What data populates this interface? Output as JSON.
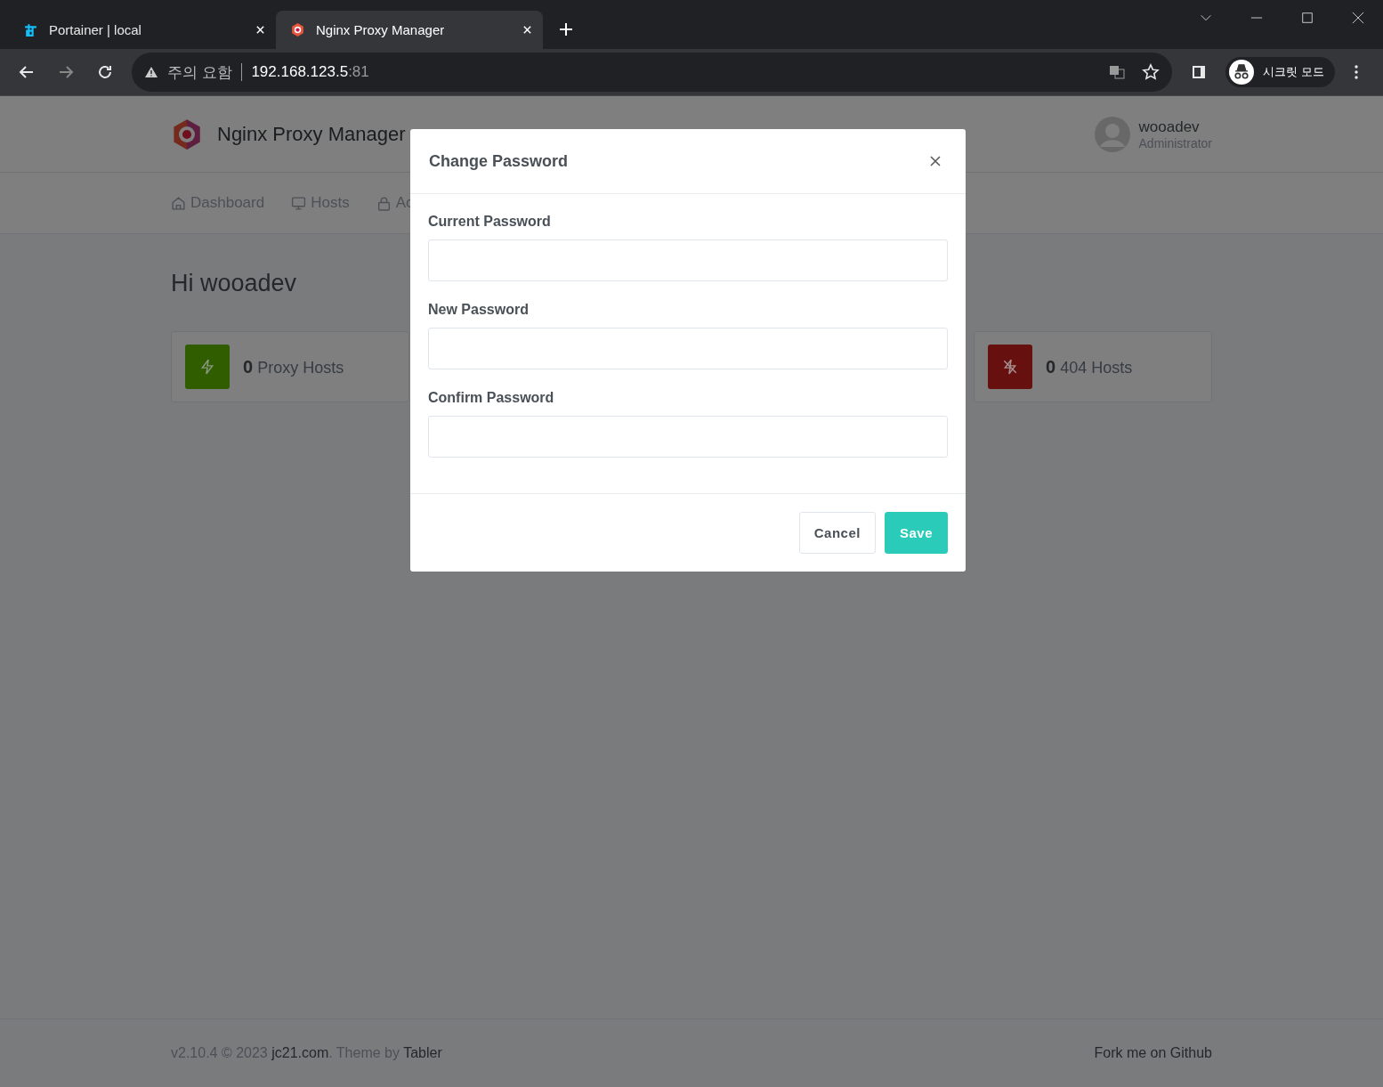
{
  "browser": {
    "tabs": [
      {
        "title": "Portainer | local",
        "selected": false,
        "kind": "crane"
      },
      {
        "title": "Nginx Proxy Manager",
        "selected": true,
        "kind": "hexagon"
      }
    ],
    "address": {
      "warning": "주의 요함",
      "host": "192.168.123.5",
      "port": ":81"
    },
    "profile": "시크릿 모드"
  },
  "app": {
    "brand": "Nginx Proxy Manager",
    "user": {
      "name": "wooadev",
      "role": "Administrator"
    },
    "nav": [
      {
        "label": "Dashboard",
        "kind": "home"
      },
      {
        "label": "Hosts",
        "kind": "monitor"
      },
      {
        "label": "Ac",
        "kind": "lock"
      }
    ],
    "greeting": "Hi wooadev",
    "stats": [
      {
        "count": "0",
        "label": "Proxy Hosts",
        "kind": "bolt",
        "color": "#2f5d00"
      },
      {
        "count": "0",
        "label": "404 Hosts",
        "kind": "bolt-off",
        "color": "#671010"
      }
    ]
  },
  "modal": {
    "title": "Change Password",
    "fields": [
      {
        "label": "Current Password"
      },
      {
        "label": "New Password"
      },
      {
        "label": "Confirm Password"
      }
    ],
    "buttons": [
      {
        "label": "Cancel",
        "kind": "secondary"
      },
      {
        "label": "Save",
        "kind": "primary"
      }
    ]
  },
  "footer": {
    "version": "v2.10.4 © 2023",
    "author_link": "jc21.com",
    "theme_text": ". Theme by",
    "theme_link": "Tabler",
    "github_link": "Fork me on Github"
  }
}
